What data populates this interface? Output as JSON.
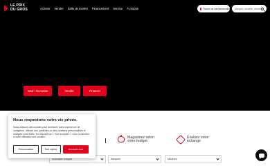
{
  "brand": {
    "line1": "LE PRIX",
    "line2": "DU GROS",
    "accent": "#e3001b"
  },
  "nav": [
    "Acheter",
    "Vendre",
    "Salle de montre",
    "Financement",
    "Service",
    "À propos"
  ],
  "header": {
    "location_button": "Trouver un concessionnaire",
    "search_placeholder": "Marque, modèle, année..."
  },
  "hero": {
    "buttons": [
      "Neuf / Occasion",
      "Vendre",
      "Financer"
    ],
    "background": "#000000"
  },
  "features": [
    {
      "line1": "Magasinez selon",
      "line2": "votre budget",
      "icon": "piggy-bank-icon"
    },
    {
      "line1": "Évaluez votre",
      "line2": "échange",
      "icon": "badge-icon"
    }
  ],
  "filters": {
    "inventory": "Inventaire complet",
    "make": "Marques",
    "model": "Modèles"
  },
  "cookie": {
    "title": "Nous respectons votre vie privée.",
    "body": "Nous utilisons des cookies pour améliorer votre expérience de navigation, diffuser des publicités ou des contenus personnalisés et analyser notre trafic. En cliquant sur « Tout accepter », vous consentez à notre utilisation des cookies.",
    "customize": "Personnaliser",
    "reject": "Tout rejeter",
    "accept": "Accepter tout"
  }
}
